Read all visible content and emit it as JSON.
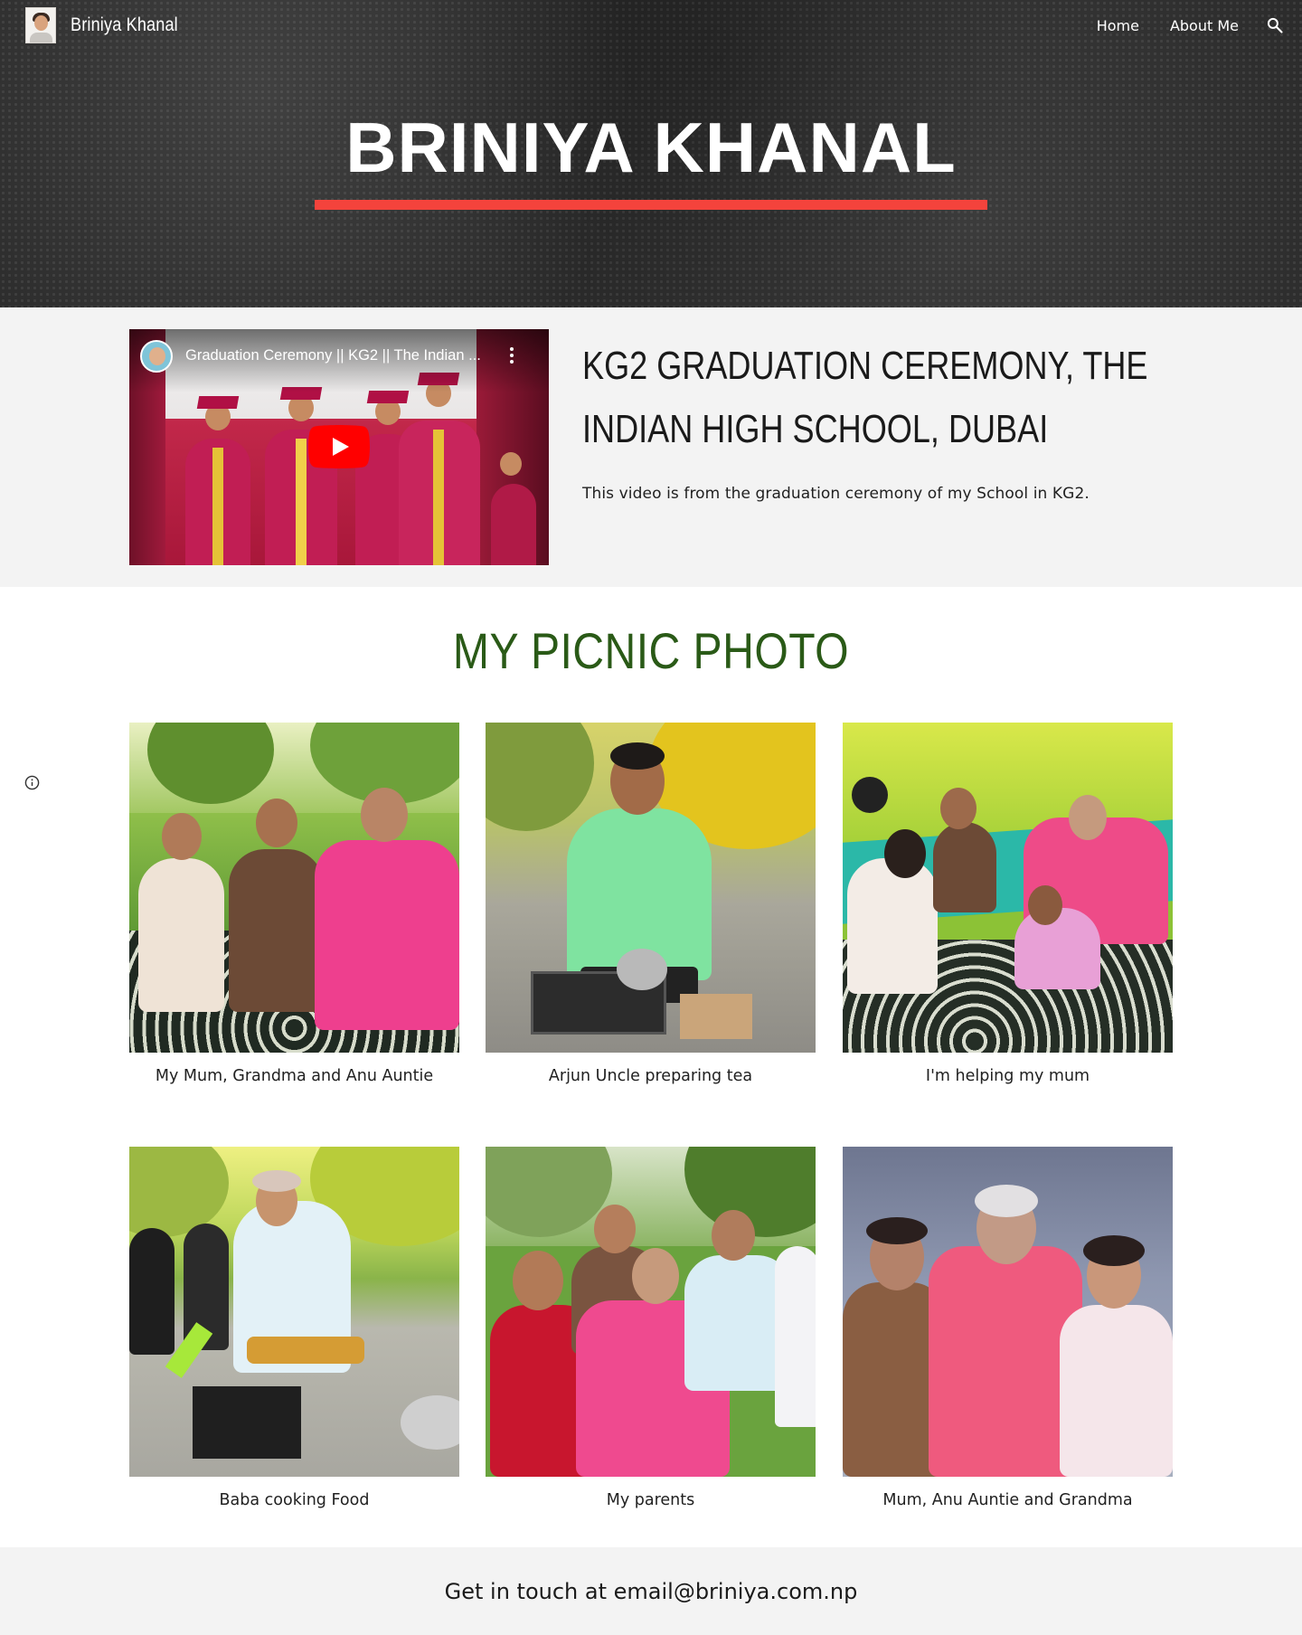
{
  "header": {
    "site_title": "Briniya Khanal",
    "nav": [
      "Home",
      "About Me"
    ],
    "search_icon": "search-icon"
  },
  "hero": {
    "title": "BRINIYA KHANAL",
    "accent_color": "#f4433c"
  },
  "video_section": {
    "video_title": "Graduation Ceremony || KG2 || The Indian ...",
    "heading": "KG2 Graduation Ceremony, The Indian High School, Dubai",
    "description": "This video is from the graduation ceremony of my School in KG2."
  },
  "gallery": {
    "title": "MY PICNIC PHOTO",
    "title_color": "#2a5a17",
    "photos": [
      {
        "caption": "My Mum, Grandma and Anu Auntie"
      },
      {
        "caption": "Arjun Uncle preparing tea"
      },
      {
        "caption": "I'm helping my mum"
      },
      {
        "caption": "Baba cooking Food"
      },
      {
        "caption": "My parents"
      },
      {
        "caption": "Mum, Anu Auntie and Grandma"
      }
    ]
  },
  "footer": {
    "text": "Get in touch at email@briniya.com.np"
  }
}
